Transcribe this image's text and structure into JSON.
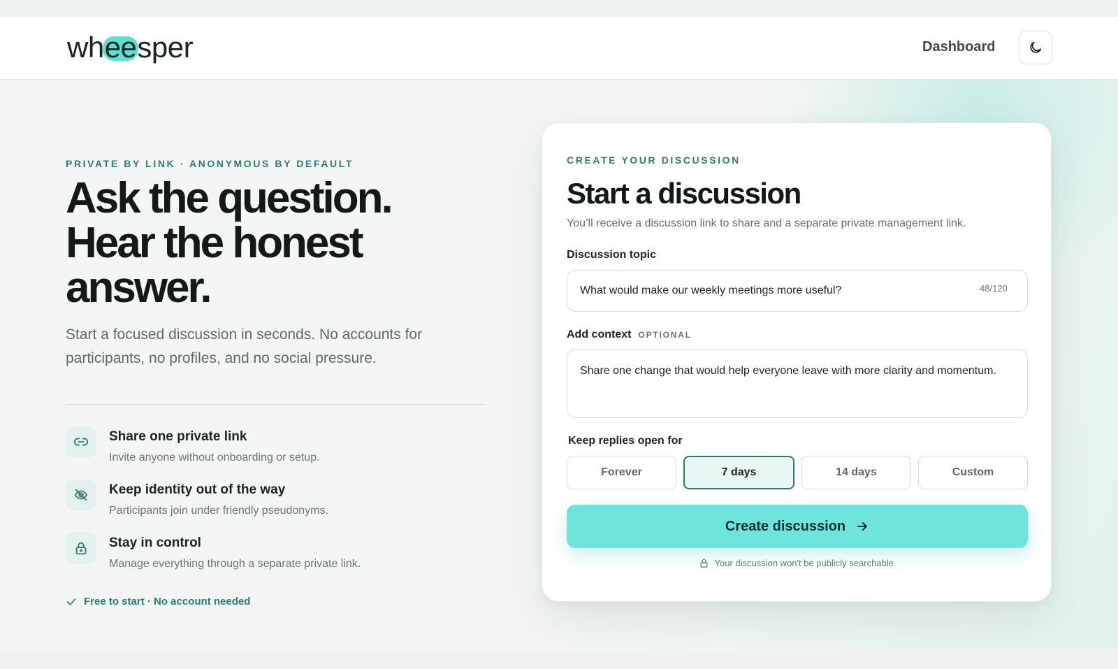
{
  "colors": {
    "accent": "#6ee4dc",
    "brand_green": "#2f7a70",
    "text_dark": "#121918"
  },
  "header": {
    "logo_prefix": "wh",
    "logo_highlight": "ee",
    "logo_suffix": "sper",
    "nav_dashboard": "Dashboard",
    "theme_toggle_icon": "moon-icon"
  },
  "hero": {
    "eyebrow": "PRIVATE BY LINK · ANONYMOUS BY DEFAULT",
    "headline_line1": "Ask the question.",
    "headline_line2": "Hear the honest",
    "headline_line3": "answer.",
    "subtext": "Start a focused discussion in seconds. No accounts for participants, no profiles, and no social pressure."
  },
  "features": [
    {
      "icon": "link-icon",
      "title": "Share one private link",
      "desc": "Invite anyone without onboarding or setup."
    },
    {
      "icon": "eye-off-icon",
      "title": "Keep identity out of the way",
      "desc": "Participants join under friendly pseudonyms."
    },
    {
      "icon": "lock-icon",
      "title": "Stay in control",
      "desc": "Manage everything through a separate private link."
    }
  ],
  "free_note": "Free to start · No account needed",
  "form": {
    "eyebrow": "CREATE YOUR DISCUSSION",
    "title": "Start a discussion",
    "desc": "You’ll receive a discussion link to share and a separate private management link.",
    "topic_label": "Discussion topic",
    "topic_value": "What would make our weekly meetings more useful?",
    "topic_counter": "48/120",
    "context_label": "Add context",
    "context_optional": "OPTIONAL",
    "context_value": "Share one change that would help everyone leave with more clarity and momentum.",
    "duration_label": "Keep replies open for",
    "durations": [
      "Forever",
      "7 days",
      "14 days",
      "Custom"
    ],
    "selected_duration": "7 days",
    "submit_label": "Create discussion",
    "privacy_note": "Your discussion won't be publicly searchable."
  }
}
